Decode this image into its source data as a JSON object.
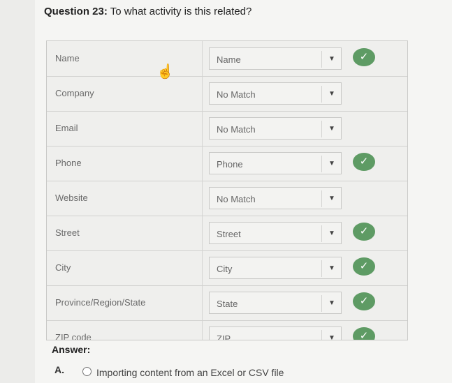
{
  "question": {
    "number": "Question 23:",
    "text": " To what activity is this related?"
  },
  "mapping_rows": [
    {
      "field": "Name",
      "selected": "Name",
      "matched": true
    },
    {
      "field": "Company",
      "selected": "No Match",
      "matched": false
    },
    {
      "field": "Email",
      "selected": "No Match",
      "matched": false
    },
    {
      "field": "Phone",
      "selected": "Phone",
      "matched": true
    },
    {
      "field": "Website",
      "selected": "No Match",
      "matched": false
    },
    {
      "field": "Street",
      "selected": "Street",
      "matched": true
    },
    {
      "field": "City",
      "selected": "City",
      "matched": true
    },
    {
      "field": "Province/Region/State",
      "selected": "State",
      "matched": true
    },
    {
      "field": "ZIP code",
      "selected": "ZIP",
      "matched": true
    }
  ],
  "icons": {
    "dropdown": "chevron-down-icon",
    "check": "checkmark-icon",
    "cursor": "hand-pointer-icon"
  },
  "colors": {
    "check_green": "#5e9b64"
  },
  "answer": {
    "label": "Answer:",
    "options": [
      {
        "letter": "A.",
        "text": "Importing content from an Excel or CSV file"
      }
    ]
  }
}
